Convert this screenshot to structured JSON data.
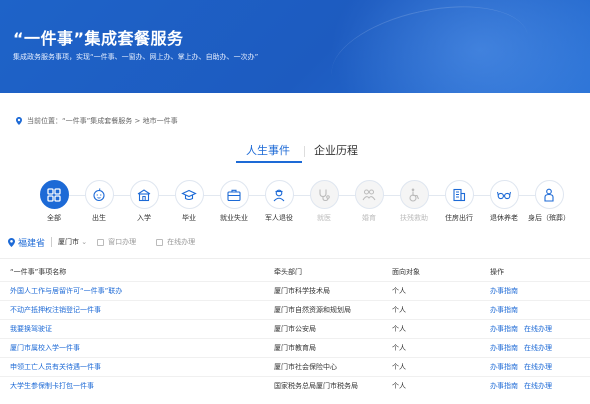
{
  "banner": {
    "title": "“一件事”集成套餐服务",
    "subtitle": "集成政务服务事项，实现“一件事、一窗办、网上办、掌上办、自助办、一次办”"
  },
  "breadcrumb": {
    "label": "当前位置：",
    "path": "“一件事”集成套餐服务 > 地市一件事"
  },
  "tabs": {
    "active": "人生事件",
    "other": "企业历程"
  },
  "categories": [
    {
      "label": "全部",
      "icon": "grid-icon"
    },
    {
      "label": "出生",
      "icon": "baby-icon"
    },
    {
      "label": "入学",
      "icon": "school-icon"
    },
    {
      "label": "毕业",
      "icon": "graduation-cap-icon"
    },
    {
      "label": "就业失业",
      "icon": "briefcase-icon"
    },
    {
      "label": "军人退役",
      "icon": "soldier-icon"
    },
    {
      "label": "就医",
      "icon": "stethoscope-icon"
    },
    {
      "label": "婚育",
      "icon": "couple-icon"
    },
    {
      "label": "扶残救助",
      "icon": "wheelchair-icon"
    },
    {
      "label": "住房出行",
      "icon": "building-icon"
    },
    {
      "label": "退休养老",
      "icon": "glasses-icon"
    },
    {
      "label": "身后（殡葬）",
      "icon": "memorial-icon"
    }
  ],
  "filter": {
    "province": "福建省",
    "city": "厦门市",
    "option1": "窗口办理",
    "option2": "在线办理"
  },
  "table": {
    "headers": [
      "“一件事”事项名称",
      "牵头部门",
      "面向对象",
      "操作"
    ],
    "rows": [
      {
        "name": "外国人工作与居留许可“一件事”联办",
        "dept": "厦门市科学技术局",
        "target": "个人",
        "actions": [
          "办事指南"
        ]
      },
      {
        "name": "不动产抵押权注销登记一件事",
        "dept": "厦门市自然资源和规划局",
        "target": "个人",
        "actions": [
          "办事指南"
        ]
      },
      {
        "name": "我要换驾驶证",
        "dept": "厦门市公安局",
        "target": "个人",
        "actions": [
          "办事指南",
          "在线办理"
        ]
      },
      {
        "name": "厦门市属校入学一件事",
        "dept": "厦门市教育局",
        "target": "个人",
        "actions": [
          "办事指南",
          "在线办理"
        ]
      },
      {
        "name": "申领工亡人员有关待遇一件事",
        "dept": "厦门市社会保险中心",
        "target": "个人",
        "actions": [
          "办事指南",
          "在线办理"
        ]
      },
      {
        "name": "大学生参保制卡打包一件事",
        "dept": "国家税务总局厦门市税务局",
        "target": "个人",
        "actions": [
          "办事指南",
          "在线办理"
        ]
      }
    ]
  },
  "colors": {
    "brand": "#1d6ad6",
    "banner": "#1e63c8"
  }
}
